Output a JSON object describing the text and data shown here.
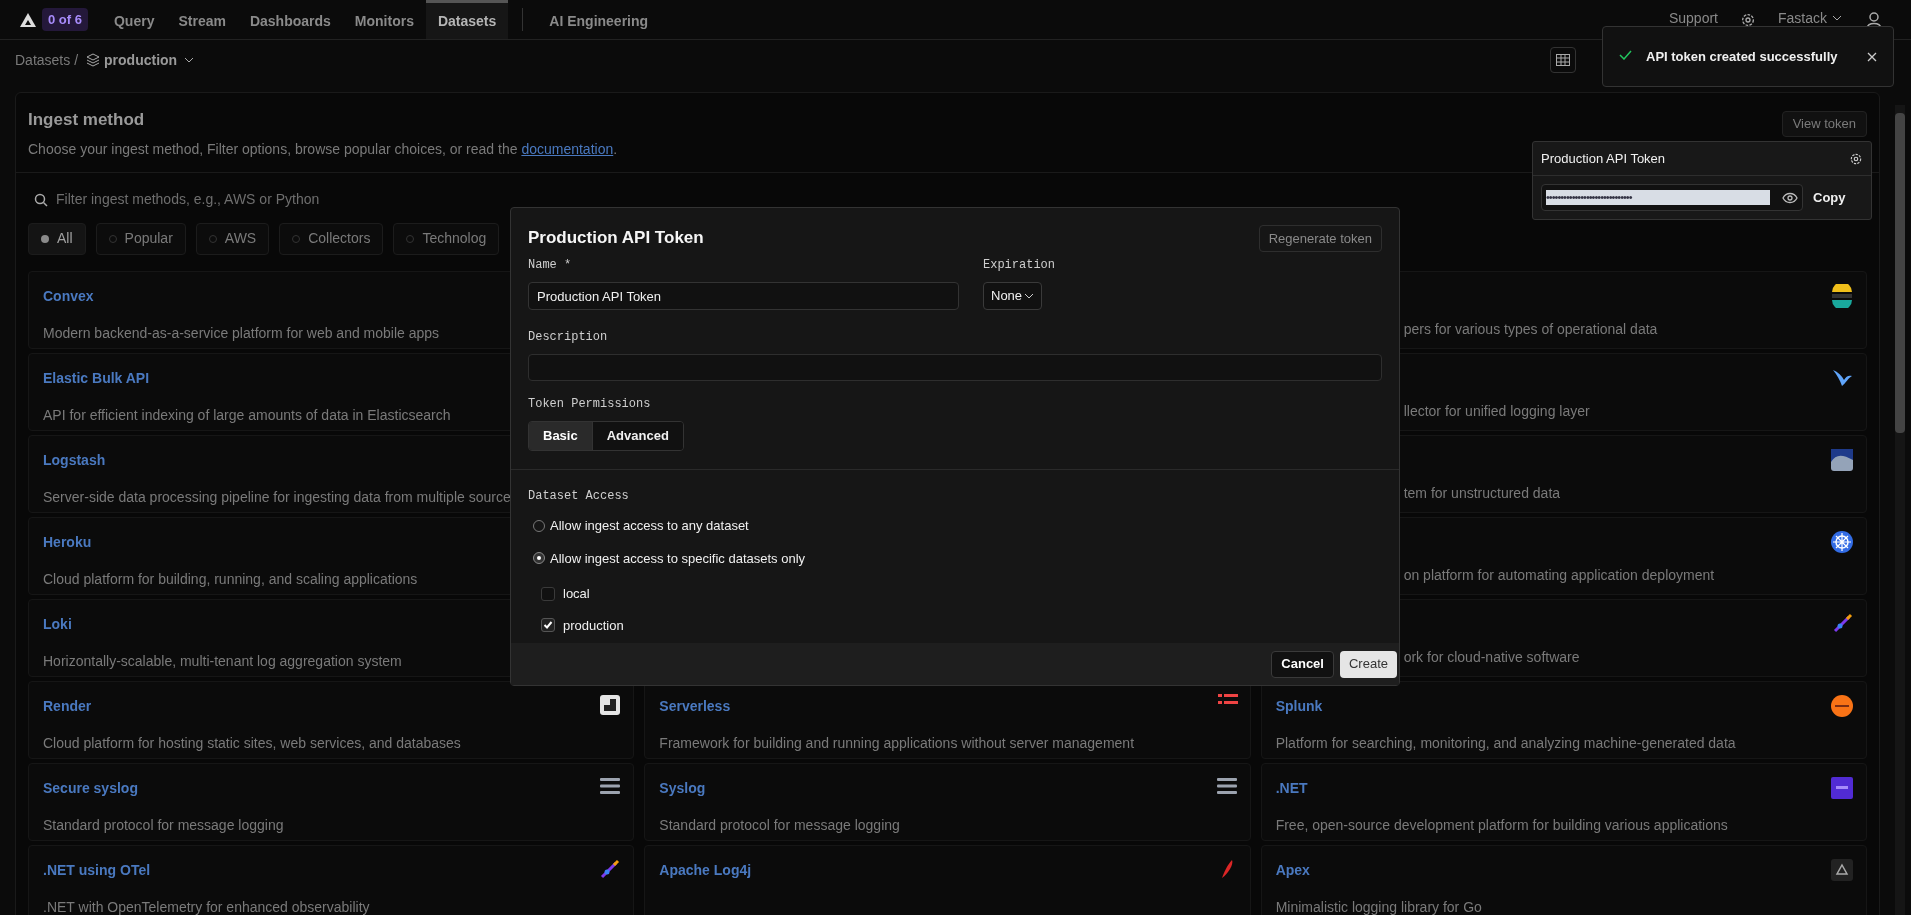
{
  "nav": {
    "badge": "0 of 6",
    "items": [
      {
        "label": "Query",
        "selected": false
      },
      {
        "label": "Stream",
        "selected": false
      },
      {
        "label": "Dashboards",
        "selected": false
      },
      {
        "label": "Monitors",
        "selected": false
      },
      {
        "label": "Datasets",
        "selected": true
      },
      {
        "label": "AI Engineering",
        "selected": false
      }
    ],
    "support": "Support",
    "account": "Fastack"
  },
  "breadcrumb": {
    "root": "Datasets /",
    "dataset": "production"
  },
  "ingest": {
    "title": "Ingest method",
    "description": "Choose your ingest method, Filter options, browse popular choices, or read the",
    "link": "documentation",
    "after_link": ".",
    "view_token": "View token",
    "search": {
      "placeholder": "Filter ingest methods, e.g., AWS or Python"
    },
    "filters": [
      {
        "label": "All",
        "selected": true
      },
      {
        "label": "Popular",
        "selected": false
      },
      {
        "label": "AWS",
        "selected": false
      },
      {
        "label": "Collectors",
        "selected": false
      },
      {
        "label": "Technolog",
        "selected": false
      }
    ],
    "columns": [
      [
        {
          "title": "Convex",
          "description": "Modern backend-as-a-service platform for web and mobile apps"
        },
        {
          "title": "Elastic Bulk API",
          "description": "API for efficient indexing of large amounts of data in Elasticsearch"
        },
        {
          "title": "Logstash",
          "description": "Server-side data processing pipeline for ingesting data from multiple source"
        },
        {
          "title": "Heroku",
          "description": "Cloud platform for building, running, and scaling applications"
        },
        {
          "title": "Loki",
          "description": "Horizontally-scalable, multi-tenant log aggregation system"
        },
        {
          "title": "Render",
          "description": "Cloud platform for hosting static sites, web services, and databases"
        },
        {
          "title": "Secure syslog",
          "description": "Standard protocol for message logging"
        },
        {
          "title": ".NET using OTel",
          "description": ".NET with OpenTelemetry for enhanced observability"
        }
      ],
      [
        {
          "title": "Serverless",
          "description": "Framework for building and running applications without server management"
        },
        {
          "title": "Syslog",
          "description": "Standard protocol for message logging"
        },
        {
          "title": "Apache Log4j"
        }
      ],
      [
        {
          "description": "pers for various types of operational data"
        },
        {
          "description": "llector for unified logging layer"
        },
        {
          "description": "tem for unstructured data"
        },
        {
          "description": "on platform for automating application deployment"
        },
        {
          "description": "ork for cloud-native software"
        },
        {
          "title": "Splunk",
          "description": "Platform for searching, monitoring, and analyzing machine-generated data"
        },
        {
          "title": ".NET",
          "description": "Free, open-source development platform for building various applications"
        },
        {
          "title": "Apex",
          "description": "Minimalistic logging library for Go"
        }
      ]
    ]
  },
  "modal": {
    "title": "Production API Token",
    "regenerate": "Regenerate token",
    "name_label": "Name *",
    "name_value": "Production API Token",
    "expiration_label": "Expiration",
    "expiration_value": "None",
    "description_label": "Description",
    "permissions_label": "Token Permissions",
    "permissions": [
      {
        "label": "Basic",
        "selected": true
      },
      {
        "label": "Advanced",
        "selected": false
      }
    ],
    "access_label": "Dataset Access",
    "access_options": [
      {
        "label": "Allow ingest access to any dataset",
        "selected": false
      },
      {
        "label": "Allow ingest access to specific datasets only",
        "selected": true
      }
    ],
    "datasets": [
      {
        "label": "local",
        "checked": false
      },
      {
        "label": "production",
        "checked": true
      }
    ],
    "cancel": "Cancel",
    "create": "Create"
  },
  "toast": {
    "message": "API token created successfully"
  },
  "token_popover": {
    "title": "Production API Token",
    "masked_value": "••••••••••••••••••••••••••••••",
    "copy": "Copy"
  }
}
